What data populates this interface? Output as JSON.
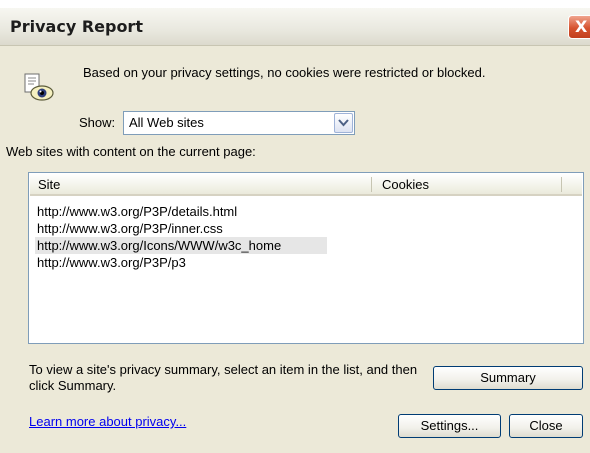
{
  "window": {
    "title": "Privacy Report",
    "close_glyph": "X"
  },
  "info": {
    "icon": "privacy-eye-icon",
    "message": "Based on your privacy settings, no cookies were restricted or blocked."
  },
  "filter": {
    "label": "Show:",
    "selected": "All Web sites"
  },
  "sites": {
    "caption": "Web sites with content on the current page:",
    "columns": [
      "Site",
      "Cookies"
    ],
    "rows": [
      {
        "site": "http://www.w3.org/P3P/details.html",
        "cookies": ""
      },
      {
        "site": "http://www.w3.org/P3P/inner.css",
        "cookies": ""
      },
      {
        "site": "http://www.w3.org/Icons/WWW/w3c_home",
        "cookies": ""
      },
      {
        "site": "http://www.w3.org/P3P/p3",
        "cookies": ""
      }
    ]
  },
  "footer": {
    "instructions": "To view a site's privacy summary, select an item in the list, and then click Summary.",
    "summary_button": "Summary",
    "learn_more_link": "Learn more about privacy...",
    "settings_button": "Settings...",
    "close_button": "Close"
  },
  "colors": {
    "dialog_background": "#ece9d8",
    "link": "#0000ee",
    "close_button": "#d6532f",
    "selected_row": "#e6e6e6"
  }
}
